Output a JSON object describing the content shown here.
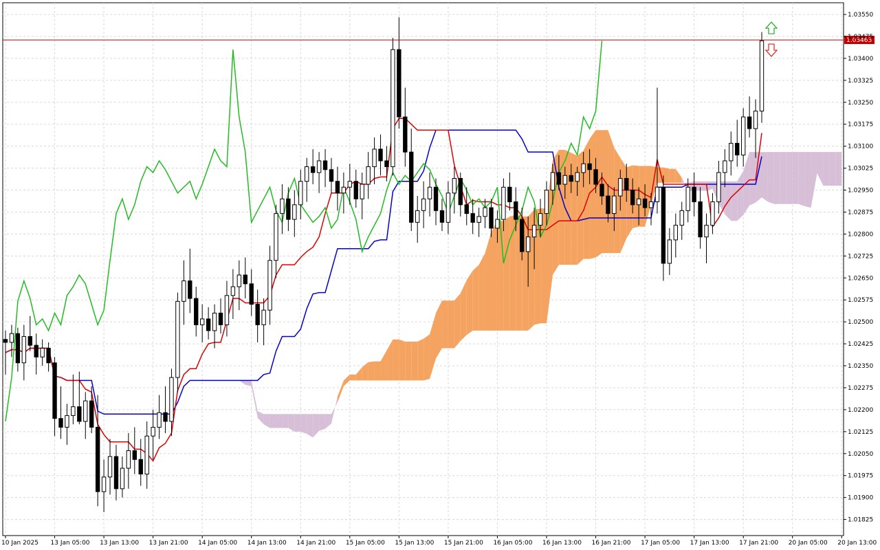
{
  "chart_data": {
    "type": "candlestick",
    "title": "",
    "xlabel": "",
    "ylabel": "",
    "ylim": [
      1.0177,
      1.0359
    ],
    "grid": true,
    "y_ticks": [
      "1.03550",
      "1.03475",
      "1.03400",
      "1.03325",
      "1.03250",
      "1.03175",
      "1.03100",
      "1.03025",
      "1.02950",
      "1.02875",
      "1.02800",
      "1.02725",
      "1.02650",
      "1.02575",
      "1.02500",
      "1.02425",
      "1.02350",
      "1.02275",
      "1.02200",
      "1.02125",
      "1.02050",
      "1.01975",
      "1.01900",
      "1.01825"
    ],
    "x_ticks": [
      "10 Jan 2025",
      "13 Jan 05:00",
      "13 Jan 13:00",
      "13 Jan 21:00",
      "14 Jan 05:00",
      "14 Jan 13:00",
      "14 Jan 21:00",
      "15 Jan 05:00",
      "15 Jan 13:00",
      "15 Jan 21:00",
      "16 Jan 05:00",
      "16 Jan 13:00",
      "16 Jan 21:00",
      "17 Jan 05:00",
      "17 Jan 13:00",
      "17 Jan 21:00",
      "20 Jan 05:00",
      "20 Jan 13:00"
    ],
    "current_price": "1.03463",
    "candles": [
      [
        1.0244,
        1.0247,
        1.0232,
        1.0243
      ],
      [
        1.0243,
        1.0249,
        1.0238,
        1.0246
      ],
      [
        1.0246,
        1.0248,
        1.0233,
        1.0236
      ],
      [
        1.0236,
        1.0249,
        1.023,
        1.0245
      ],
      [
        1.0245,
        1.0252,
        1.024,
        1.0242
      ],
      [
        1.0242,
        1.0246,
        1.0232,
        1.0238
      ],
      [
        1.0238,
        1.0244,
        1.0235,
        1.0241
      ],
      [
        1.0241,
        1.0243,
        1.0233,
        1.0236
      ],
      [
        1.0236,
        1.0238,
        1.0211,
        1.0217
      ],
      [
        1.0217,
        1.0228,
        1.021,
        1.0214
      ],
      [
        1.0214,
        1.0222,
        1.0208,
        1.0218
      ],
      [
        1.0218,
        1.0232,
        1.0215,
        1.0221
      ],
      [
        1.0221,
        1.0233,
        1.0215,
        1.0216
      ],
      [
        1.0216,
        1.0226,
        1.021,
        1.0223
      ],
      [
        1.0223,
        1.0228,
        1.0212,
        1.0214
      ],
      [
        1.0214,
        1.0225,
        1.0187,
        1.0192
      ],
      [
        1.0192,
        1.0203,
        1.0185,
        1.0197
      ],
      [
        1.0197,
        1.021,
        1.0191,
        1.0204
      ],
      [
        1.0204,
        1.0208,
        1.0189,
        1.0193
      ],
      [
        1.0193,
        1.0204,
        1.019,
        1.02
      ],
      [
        1.02,
        1.0212,
        1.0193,
        1.0206
      ],
      [
        1.0206,
        1.0214,
        1.0198,
        1.0203
      ],
      [
        1.0203,
        1.021,
        1.0194,
        1.0198
      ],
      [
        1.0198,
        1.0216,
        1.0193,
        1.0211
      ],
      [
        1.0211,
        1.022,
        1.0203,
        1.0214
      ],
      [
        1.0214,
        1.0225,
        1.021,
        1.0219
      ],
      [
        1.0219,
        1.0228,
        1.0212,
        1.0216
      ],
      [
        1.0216,
        1.0234,
        1.0211,
        1.0231
      ],
      [
        1.0231,
        1.026,
        1.0226,
        1.0257
      ],
      [
        1.0257,
        1.0271,
        1.0249,
        1.0264
      ],
      [
        1.0264,
        1.0275,
        1.0253,
        1.0258
      ],
      [
        1.0258,
        1.0262,
        1.0245,
        1.0249
      ],
      [
        1.0249,
        1.0256,
        1.0243,
        1.0251
      ],
      [
        1.0251,
        1.0255,
        1.0244,
        1.0247
      ],
      [
        1.0247,
        1.0256,
        1.0241,
        1.0253
      ],
      [
        1.0253,
        1.0258,
        1.0246,
        1.0249
      ],
      [
        1.0249,
        1.0264,
        1.0245,
        1.0259
      ],
      [
        1.0259,
        1.0268,
        1.0251,
        1.0262
      ],
      [
        1.0262,
        1.0271,
        1.0254,
        1.0266
      ],
      [
        1.0266,
        1.0272,
        1.0258,
        1.0263
      ],
      [
        1.0263,
        1.0268,
        1.0252,
        1.0256
      ],
      [
        1.0256,
        1.0261,
        1.0243,
        1.0249
      ],
      [
        1.0249,
        1.0258,
        1.0242,
        1.0254
      ],
      [
        1.0254,
        1.0276,
        1.0249,
        1.0271
      ],
      [
        1.0271,
        1.029,
        1.0265,
        1.0287
      ],
      [
        1.0287,
        1.0297,
        1.028,
        1.0292
      ],
      [
        1.0292,
        1.0296,
        1.0281,
        1.0285
      ],
      [
        1.0285,
        1.0295,
        1.0279,
        1.029
      ],
      [
        1.029,
        1.0302,
        1.0285,
        1.0298
      ],
      [
        1.0298,
        1.0306,
        1.0291,
        1.0303
      ],
      [
        1.0303,
        1.0309,
        1.0297,
        1.0301
      ],
      [
        1.0301,
        1.0308,
        1.0294,
        1.0305
      ],
      [
        1.0305,
        1.0309,
        1.0296,
        1.0302
      ],
      [
        1.0302,
        1.0306,
        1.0294,
        1.0298
      ],
      [
        1.0298,
        1.0303,
        1.0288,
        1.0294
      ],
      [
        1.0294,
        1.0301,
        1.0287,
        1.0296
      ],
      [
        1.0296,
        1.0304,
        1.029,
        1.0298
      ],
      [
        1.0298,
        1.0302,
        1.0289,
        1.0292
      ],
      [
        1.0292,
        1.0301,
        1.0285,
        1.0297
      ],
      [
        1.0297,
        1.0308,
        1.0292,
        1.0303
      ],
      [
        1.0303,
        1.0313,
        1.0297,
        1.0309
      ],
      [
        1.0309,
        1.0314,
        1.03,
        1.0305
      ],
      [
        1.0305,
        1.031,
        1.0298,
        1.0303
      ],
      [
        1.0303,
        1.0347,
        1.03,
        1.0343
      ],
      [
        1.0343,
        1.0354,
        1.0316,
        1.032
      ],
      [
        1.032,
        1.033,
        1.0303,
        1.0308
      ],
      [
        1.0308,
        1.0316,
        1.0281,
        1.0284
      ],
      [
        1.0284,
        1.0293,
        1.0277,
        1.0288
      ],
      [
        1.0288,
        1.0298,
        1.0282,
        1.0292
      ],
      [
        1.0292,
        1.0301,
        1.0286,
        1.0296
      ],
      [
        1.0296,
        1.0299,
        1.0283,
        1.0288
      ],
      [
        1.0288,
        1.0292,
        1.0281,
        1.0284
      ],
      [
        1.0284,
        1.0298,
        1.028,
        1.0294
      ],
      [
        1.0294,
        1.0303,
        1.0287,
        1.0299
      ],
      [
        1.0299,
        1.0301,
        1.0286,
        1.029
      ],
      [
        1.029,
        1.0296,
        1.0283,
        1.0287
      ],
      [
        1.0287,
        1.0292,
        1.028,
        1.0284
      ],
      [
        1.0284,
        1.0289,
        1.0279,
        1.0286
      ],
      [
        1.0286,
        1.0292,
        1.0282,
        1.0289
      ],
      [
        1.0289,
        1.0292,
        1.0279,
        1.0282
      ],
      [
        1.0282,
        1.0288,
        1.0277,
        1.0285
      ],
      [
        1.0285,
        1.0299,
        1.0281,
        1.0296
      ],
      [
        1.0296,
        1.0301,
        1.0288,
        1.0291
      ],
      [
        1.0291,
        1.0296,
        1.0281,
        1.0285
      ],
      [
        1.0285,
        1.0289,
        1.0271,
        1.0274
      ],
      [
        1.0274,
        1.0286,
        1.0262,
        1.0279
      ],
      [
        1.0279,
        1.0289,
        1.0268,
        1.0283
      ],
      [
        1.0283,
        1.0292,
        1.0279,
        1.0287
      ],
      [
        1.0287,
        1.0298,
        1.0283,
        1.0295
      ],
      [
        1.0295,
        1.0304,
        1.029,
        1.0301
      ],
      [
        1.0301,
        1.0307,
        1.0295,
        1.0297
      ],
      [
        1.0297,
        1.0303,
        1.0292,
        1.03
      ],
      [
        1.03,
        1.0304,
        1.0294,
        1.0298
      ],
      [
        1.0298,
        1.0303,
        1.0293,
        1.0301
      ],
      [
        1.0301,
        1.0308,
        1.0296,
        1.0304
      ],
      [
        1.0304,
        1.0309,
        1.0297,
        1.0302
      ],
      [
        1.0302,
        1.0306,
        1.0294,
        1.0297
      ],
      [
        1.0297,
        1.0301,
        1.029,
        1.0293
      ],
      [
        1.0293,
        1.0297,
        1.0284,
        1.0287
      ],
      [
        1.0287,
        1.0296,
        1.0281,
        1.0293
      ],
      [
        1.0293,
        1.0302,
        1.0288,
        1.0299
      ],
      [
        1.0299,
        1.0304,
        1.0291,
        1.0295
      ],
      [
        1.0295,
        1.0299,
        1.0287,
        1.029
      ],
      [
        1.029,
        1.0296,
        1.0283,
        1.0292
      ],
      [
        1.0292,
        1.0297,
        1.0286,
        1.0289
      ],
      [
        1.0289,
        1.0294,
        1.0283,
        1.0291
      ],
      [
        1.0291,
        1.033,
        1.0287,
        1.0296
      ],
      [
        1.0296,
        1.03,
        1.0264,
        1.027
      ],
      [
        1.027,
        1.0282,
        1.0266,
        1.0278
      ],
      [
        1.0278,
        1.0287,
        1.0272,
        1.0283
      ],
      [
        1.0283,
        1.0291,
        1.0278,
        1.0288
      ],
      [
        1.0288,
        1.0299,
        1.0284,
        1.0296
      ],
      [
        1.0296,
        1.0301,
        1.0286,
        1.0291
      ],
      [
        1.0291,
        1.0296,
        1.0275,
        1.0279
      ],
      [
        1.0279,
        1.0287,
        1.027,
        1.0283
      ],
      [
        1.0283,
        1.0294,
        1.028,
        1.0291
      ],
      [
        1.0291,
        1.0305,
        1.0287,
        1.0301
      ],
      [
        1.0301,
        1.0309,
        1.0296,
        1.0305
      ],
      [
        1.0305,
        1.0315,
        1.03,
        1.0311
      ],
      [
        1.0311,
        1.0319,
        1.0303,
        1.0307
      ],
      [
        1.0307,
        1.0323,
        1.0303,
        1.032
      ],
      [
        1.032,
        1.0327,
        1.0313,
        1.0316
      ],
      [
        1.0316,
        1.0326,
        1.0306,
        1.0322
      ],
      [
        1.0322,
        1.0349,
        1.0318,
        1.0346
      ]
    ]
  },
  "indicators": {
    "tenkan_color": "#dd0000",
    "kijun_color": "#0000cc",
    "chikou_color": "#22bb22",
    "cloud_up_color": "#f4a460",
    "cloud_down_color": "#d8bfd8",
    "price_line_color": "#c00000",
    "arrow_up_color": "#22aa22",
    "arrow_down_color": "#dd2222",
    "candle_up_color": "#ffffff",
    "candle_down_color": "#000000"
  }
}
